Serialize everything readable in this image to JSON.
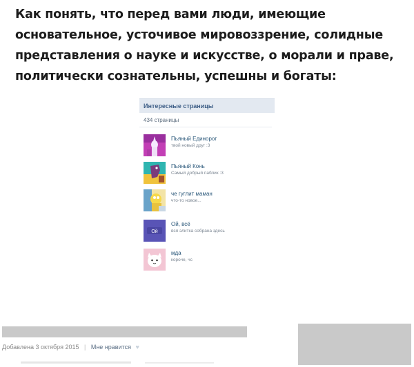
{
  "headline": "Как понять, что перед вами люди, имеющие основательное, усточивое мировоззрение, солидные представления о науке и искусстве, о морали и праве, политически сознательны, успешны и богаты:",
  "widget": {
    "title": "Интересные страницы",
    "count": "434 страницы",
    "pages": [
      {
        "name": "Пьяный Единорог",
        "description": "твой новый друг :3",
        "avatar_icon": "unicorn-avatar"
      },
      {
        "name": "Пьяный Конь",
        "description": "Самый добрый паблик :3",
        "avatar_icon": "horse-avatar"
      },
      {
        "name": "че гуглит маман",
        "description": "что-то новое...",
        "avatar_icon": "cartoon-avatar"
      },
      {
        "name": "Ой, всё",
        "description": "вся элитка собрана здесь",
        "avatar_icon": "oi-vse-avatar",
        "avatar_text": "Ой"
      },
      {
        "name": "мда",
        "description": "короче, чс",
        "avatar_icon": "cat-avatar"
      }
    ]
  },
  "footer": {
    "date": "Добавлена 3 октября 2015",
    "separator": "|",
    "like_label": "Мне нравится",
    "like_icon": "heart-icon"
  },
  "colors": {
    "header_bg": "#e3e9f1",
    "title_color": "#3f5f87",
    "link_color": "#2b587a",
    "redaction_gray": "#c9c9c9"
  }
}
